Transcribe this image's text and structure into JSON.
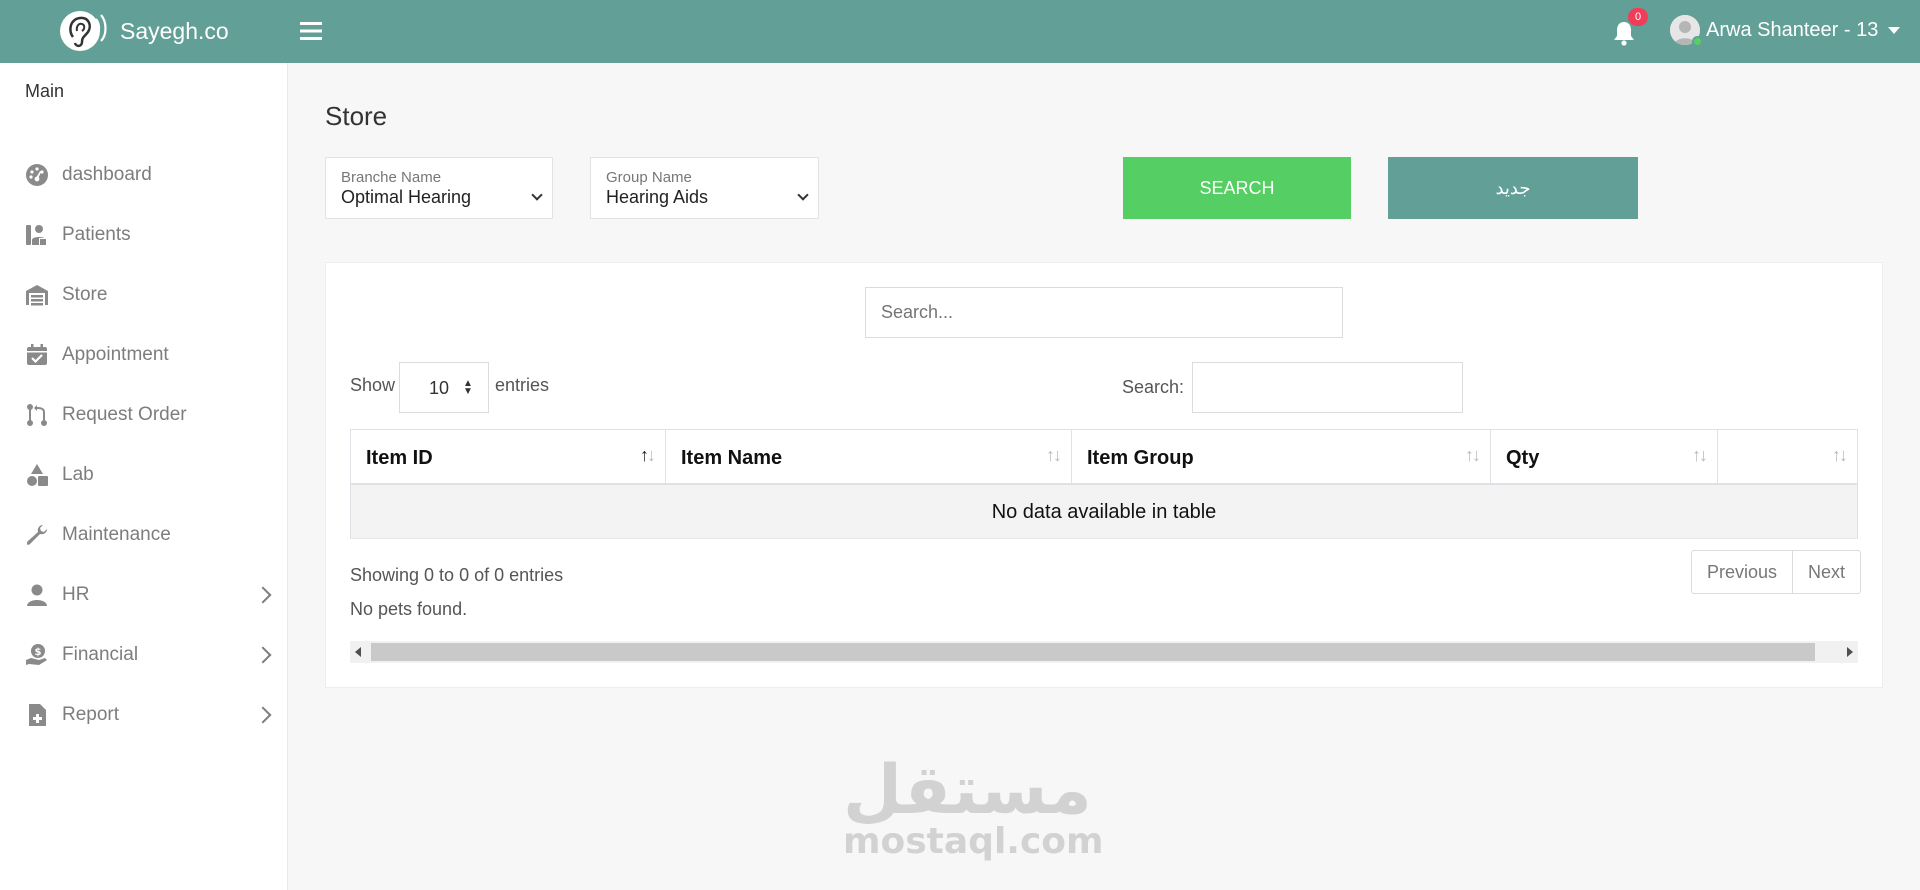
{
  "header": {
    "brand": "Sayegh.co",
    "notification_count": "0",
    "user_name": "Arwa Shanteer - 13"
  },
  "sidebar": {
    "section_title": "Main",
    "items": [
      {
        "label": "dashboard",
        "icon": "dashboard-icon"
      },
      {
        "label": "Patients",
        "icon": "patients-icon"
      },
      {
        "label": "Store",
        "icon": "warehouse-icon"
      },
      {
        "label": "Appointment",
        "icon": "calendar-check-icon"
      },
      {
        "label": "Request Order",
        "icon": "code-branch-icon"
      },
      {
        "label": "Lab",
        "icon": "shapes-icon"
      },
      {
        "label": "Maintenance",
        "icon": "wrench-icon"
      },
      {
        "label": "HR",
        "icon": "user-icon"
      },
      {
        "label": "Financial",
        "icon": "hand-dollar-icon"
      },
      {
        "label": "Report",
        "icon": "file-medical-icon"
      }
    ]
  },
  "page": {
    "title": "Store"
  },
  "filters": {
    "branch_label": "Branche Name",
    "branch_value": "Optimal Hearing",
    "group_label": "Group Name",
    "group_value": "Hearing Aids",
    "search_button": "SEARCH",
    "new_button": "جديد"
  },
  "table_controls": {
    "top_search_placeholder": "Search...",
    "show_label": "Show",
    "page_length": "10",
    "entries_label": "entries",
    "filter_label": "Search:"
  },
  "table": {
    "columns": [
      "Item ID",
      "Item Name",
      "Item Group",
      "Qty",
      ""
    ],
    "empty_message": "No data available in table"
  },
  "footer": {
    "info": "Showing 0 to 0 of 0 entries",
    "no_pets": "No pets found.",
    "previous": "Previous",
    "next": "Next"
  },
  "watermark": {
    "arabic": "مستقل",
    "latin": "mostaql.com"
  },
  "colors": {
    "header_bg": "#629f97",
    "search_button": "#55ce63",
    "new_button": "#629f97",
    "badge": "#f03e5a"
  }
}
